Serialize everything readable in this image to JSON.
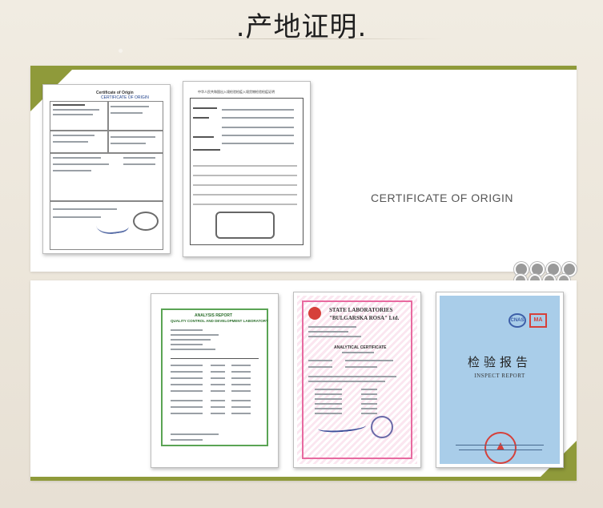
{
  "page": {
    "title": ".产地证明."
  },
  "panel_top": {
    "caption": "CERTIFICATE OF ORIGIN",
    "doc1": {
      "heading": "Certificate of Origin",
      "subheading": "CERTIFICATE OF ORIGIN"
    },
    "doc2": {
      "heading": "中华人民共和国出入境检验检疫入境货物检验检疫证明"
    },
    "slider_dots": 4
  },
  "panel_bottom": {
    "doc_analysis": {
      "heading": "ANALYSIS REPORT",
      "subheading": "QUALITY CONTROL AND DEVELOPMENT LABORATORY"
    },
    "doc_state_lab": {
      "heading": "STATE LABORATORIES",
      "subheading": "\"BULGARSKA ROSA\" Ltd.",
      "cert_title": "ANALYTICAL CERTIFICATE"
    },
    "doc_inspect": {
      "title_cn": "检验报告",
      "title_en": "INSPECT REPORT",
      "logo_left": "CNAS",
      "logo_right": "MA"
    }
  },
  "colors": {
    "accent_olive": "#8f9a3a",
    "analysis_border": "#5aa454",
    "state_lab_pink": "#e86aa0",
    "inspect_blue": "#a9cde9",
    "seal_red": "#d6403a"
  }
}
